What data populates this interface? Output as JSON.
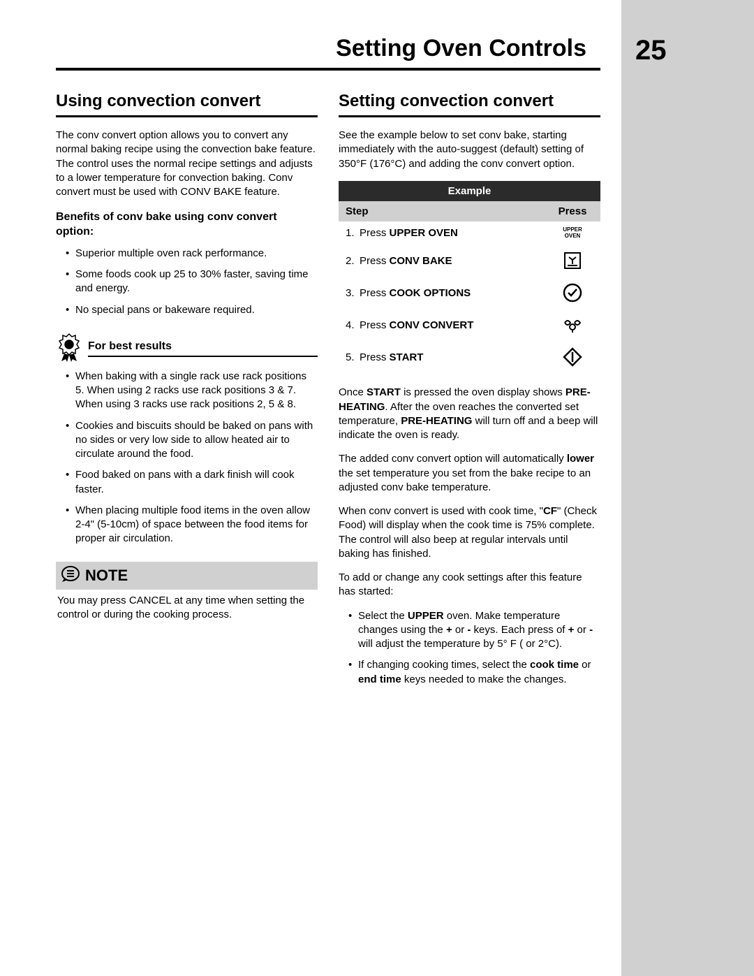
{
  "header": {
    "title": "Setting Oven Controls",
    "page_number": "25"
  },
  "left": {
    "heading": "Using convection convert",
    "intro": "The conv convert option allows you to convert any normal baking recipe using the convection bake feature. The control uses the normal recipe settings and adjusts to a lower temperature for convection baking. Conv convert must be used with CONV BAKE feature.",
    "benefits_heading": "Benefits of conv bake using conv convert option:",
    "benefits": [
      "Superior multiple oven rack performance.",
      "Some foods cook up 25 to 30% faster, saving time and energy.",
      "No special pans or bakeware required."
    ],
    "best_results_label": "For best results",
    "best_results": [
      "When baking with a single rack use rack positions 5. When using 2 racks use rack positions 3 & 7. When using 3 racks use rack positions 2, 5 & 8.",
      "Cookies and biscuits should be baked on pans with no sides or very low side to allow heated air to circulate around the food.",
      "Food baked on pans with a dark finish will cook faster.",
      "When placing multiple food items in the oven allow 2-4\" (5-10cm) of space between the food items for proper air circulation."
    ],
    "note_label": "NOTE",
    "note_body": "You may press CANCEL at any time when setting the control or during the cooking process."
  },
  "right": {
    "heading": "Setting convection convert",
    "intro": "See the example below to set conv bake, starting immediately with the auto-suggest (default) setting of 350°F (176°C) and adding the conv convert option.",
    "table": {
      "title": "Example",
      "col_step": "Step",
      "col_press": "Press",
      "rows": [
        {
          "num": "1.",
          "text_prefix": "Press ",
          "text_bold": "UPPER OVEN",
          "icon": "upper-oven"
        },
        {
          "num": "2.",
          "text_prefix": "Press ",
          "text_bold": "CONV BAKE",
          "icon": "conv-bake"
        },
        {
          "num": "3.",
          "text_prefix": "Press ",
          "text_bold": "COOK OPTIONS",
          "icon": "cook-options"
        },
        {
          "num": "4.",
          "text_prefix": "Press ",
          "text_bold": "CONV CONVERT",
          "icon": "conv-convert"
        },
        {
          "num": "5.",
          "text_prefix": "Press ",
          "text_bold": "START",
          "icon": "start"
        }
      ],
      "upper_oven_lines": [
        "UPPER",
        "OVEN"
      ]
    },
    "after_1_pre": "Once ",
    "after_1_b1": "START",
    "after_1_mid1": " is pressed the oven display shows ",
    "after_1_b2": "PRE-HEATING",
    "after_1_mid2": ". After the oven reaches the converted set temperature, ",
    "after_1_b3": "PRE-HEATING",
    "after_1_end": " will turn off and a beep will indicate the oven is ready.",
    "after_2_pre": "The added conv convert option will automatically ",
    "after_2_b1": "lower",
    "after_2_end": " the set temperature you set from the bake recipe to an adjusted conv bake temperature.",
    "after_3_pre": "When conv convert is used with cook time, \"",
    "after_3_b1": "CF",
    "after_3_end": "\" (Check Food) will display when the cook time is 75% complete. The control will also beep at regular intervals until baking has finished.",
    "after_4": "To add or change any cook settings after this feature has started:",
    "change_b1_pre": "Select the ",
    "change_b1_b1": "UPPER",
    "change_b1_mid1": " oven. Make temperature changes using the ",
    "change_b1_b2": "+",
    "change_b1_mid2": " or ",
    "change_b1_b3": "-",
    "change_b1_mid3": " keys. Each press of ",
    "change_b1_b4": "+",
    "change_b1_mid4": " or ",
    "change_b1_b5": "-",
    "change_b1_end": " will adjust the temperature by 5° F ( or 2°C).",
    "change_b2_pre": "If changing cooking times, select the ",
    "change_b2_b1": "cook time",
    "change_b2_mid": " or ",
    "change_b2_b2": "end time",
    "change_b2_end": " keys needed to make the changes."
  }
}
